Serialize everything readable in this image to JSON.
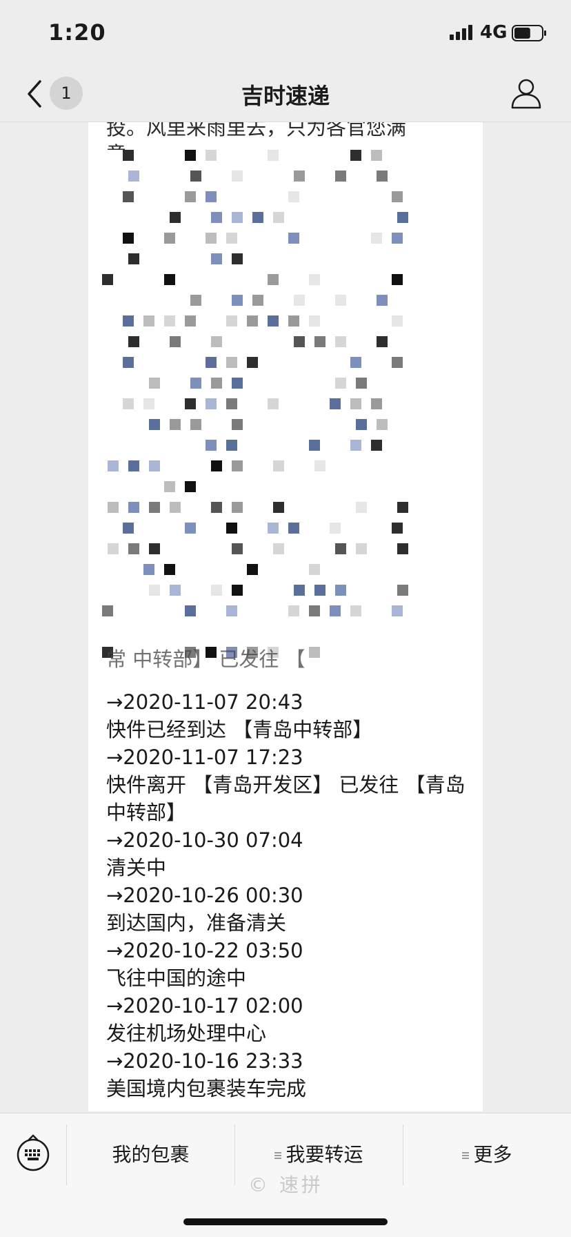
{
  "status_bar": {
    "time": "1:20",
    "network": "4G",
    "battery_level": 0.6
  },
  "nav": {
    "unread_count": "1",
    "title": "吉时速递"
  },
  "message": {
    "top_text": "投。风里来雨里去，只为各官您满",
    "top_text_cont": "意",
    "tail_text": "常    中转部】 已发往 【",
    "tracking": [
      {
        "time": "→2020-11-07 20:43",
        "desc": "快件已经到达 【青岛中转部】"
      },
      {
        "time": "→2020-11-07 17:23",
        "desc": "快件离开 【青岛开发区】 已发往 【青岛中转部】"
      },
      {
        "time": "→2020-10-30 07:04",
        "desc": "清关中"
      },
      {
        "time": "→2020-10-26 00:30",
        "desc": "到达国内，准备清关"
      },
      {
        "time": "→2020-10-22 03:50",
        "desc": "飞往中国的途中"
      },
      {
        "time": "→2020-10-17 02:00",
        "desc": "发往机场处理中心"
      },
      {
        "time": "→2020-10-16 23:33",
        "desc": "美国境内包裹装车完成"
      }
    ]
  },
  "bottom_menu": {
    "items": [
      {
        "label": "我的包裹",
        "has_submenu": false
      },
      {
        "label": "我要转运",
        "has_submenu": true
      },
      {
        "label": "更多",
        "has_submenu": true
      }
    ],
    "watermark": "© 速拼"
  },
  "colors": {
    "background": "#ededed",
    "bubble": "#ffffff",
    "text": "#1a1a1a",
    "menu_background": "#f7f7f7"
  },
  "icons": [
    "signal-icon",
    "battery-icon",
    "back-chevron-icon",
    "profile-icon",
    "keyboard-icon",
    "submenu-icon"
  ]
}
